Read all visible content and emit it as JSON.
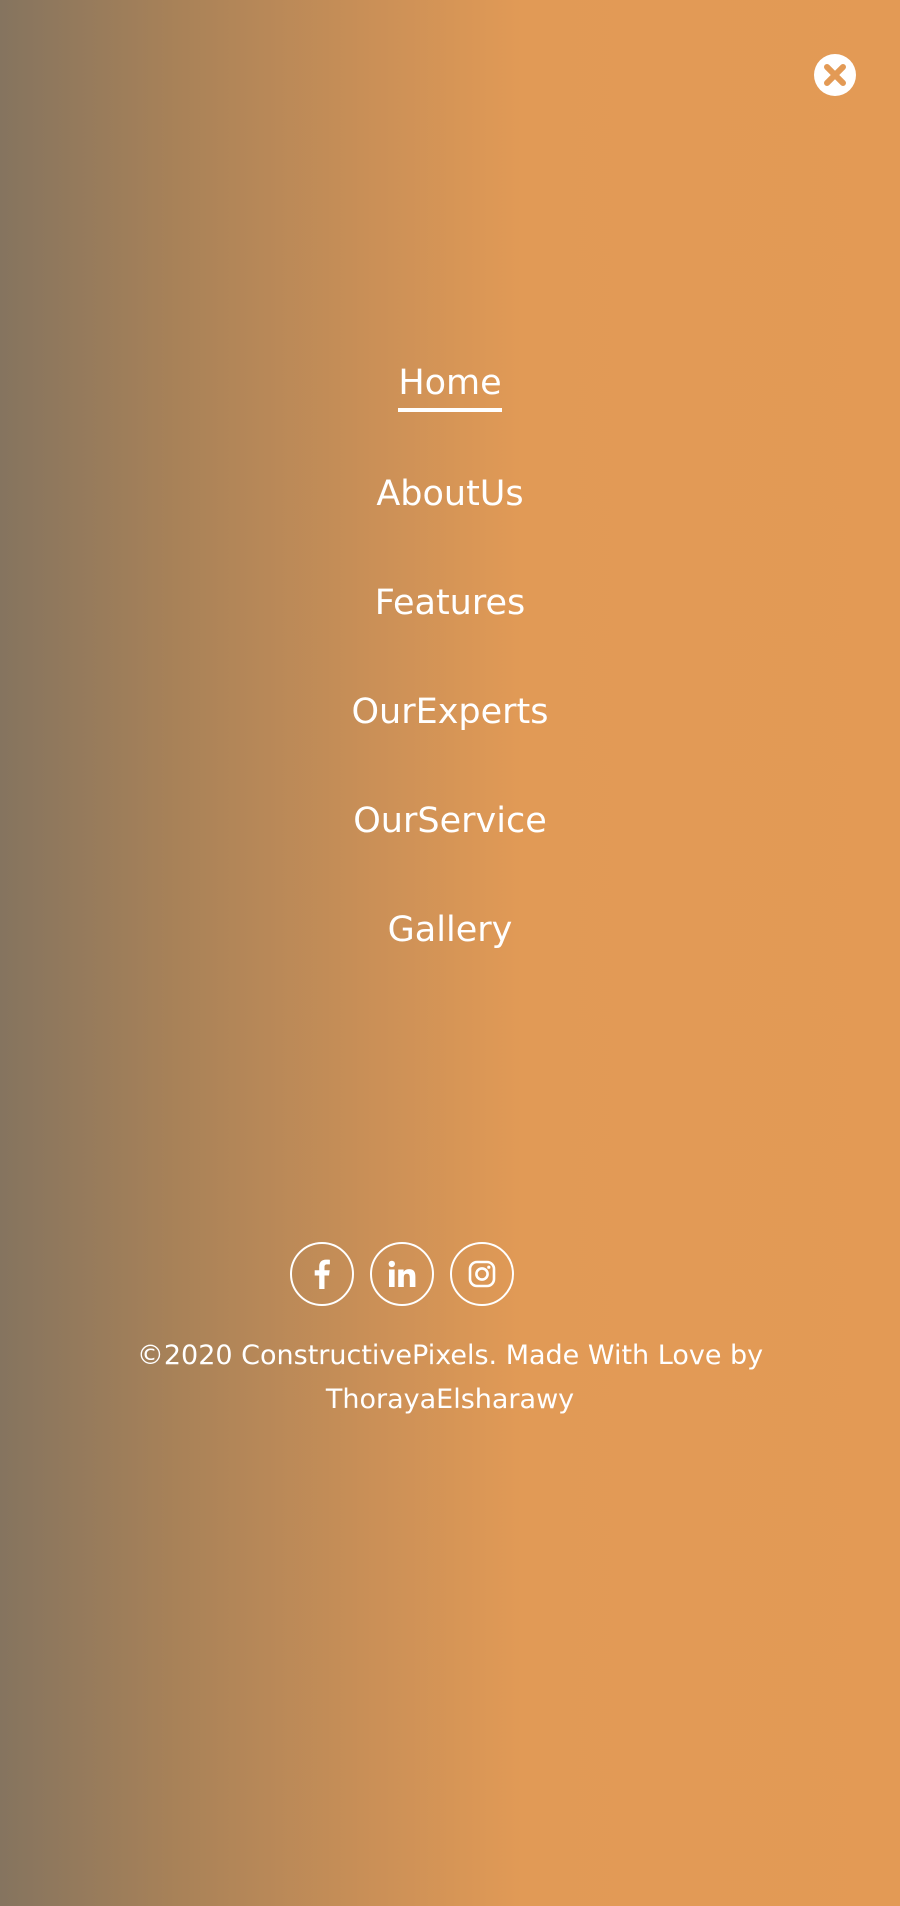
{
  "colors": {
    "gradient_left": "#85745f",
    "gradient_right": "#e39a55",
    "text": "#ffffff"
  },
  "close_button": {
    "icon": "close-icon"
  },
  "nav": {
    "items": [
      {
        "label": "Home",
        "active": true
      },
      {
        "label": "AboutUs",
        "active": false
      },
      {
        "label": "Features",
        "active": false
      },
      {
        "label": "OurExperts",
        "active": false
      },
      {
        "label": "OurService",
        "active": false
      },
      {
        "label": "Gallery",
        "active": false
      }
    ]
  },
  "social": {
    "items": [
      {
        "icon": "facebook-icon"
      },
      {
        "icon": "linkedin-icon"
      },
      {
        "icon": "instagram-icon"
      }
    ]
  },
  "footer": {
    "line1": "©2020 ConstructivePixels. Made With Love by",
    "line2": "ThorayaElsharawy"
  }
}
